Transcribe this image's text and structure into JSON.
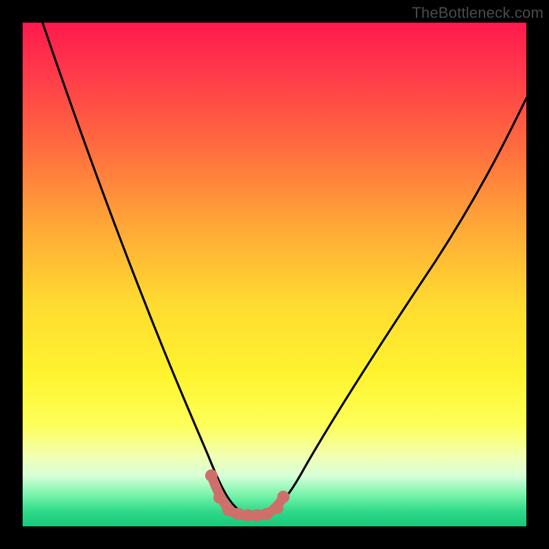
{
  "watermark": "TheBottleneck.com",
  "chart_data": {
    "type": "line",
    "title": "",
    "xlabel": "",
    "ylabel": "",
    "xlim": [
      0,
      100
    ],
    "ylim": [
      0,
      100
    ],
    "grid": false,
    "series": [
      {
        "name": "bottleneck-curve",
        "color": "#000000",
        "x": [
          4,
          8,
          12,
          16,
          20,
          24,
          28,
          32,
          35,
          37,
          39,
          41,
          43,
          44,
          45,
          46,
          48,
          50,
          52,
          56,
          62,
          70,
          80,
          90,
          100
        ],
        "y": [
          100,
          87,
          75,
          64,
          54,
          44,
          35,
          26,
          18,
          13,
          9,
          6,
          3.5,
          2.8,
          2.5,
          2.5,
          2.6,
          3,
          5,
          11,
          22,
          38,
          57,
          76,
          95
        ]
      },
      {
        "name": "optimal-zone-markers",
        "color": "#cf6f6a",
        "x": [
          37.5,
          39,
          41,
          43,
          45,
          47,
          49,
          50.5,
          51.7
        ],
        "y": [
          10,
          5.5,
          3.2,
          2.6,
          2.5,
          2.5,
          2.7,
          3.5,
          5.8
        ]
      }
    ],
    "annotations": []
  },
  "colors": {
    "background": "#000000",
    "gradient_top": "#ff1a4d",
    "gradient_bottom": "#17c978",
    "curve": "#000000",
    "markers": "#cf6f6a",
    "watermark": "#4b4b4b"
  }
}
